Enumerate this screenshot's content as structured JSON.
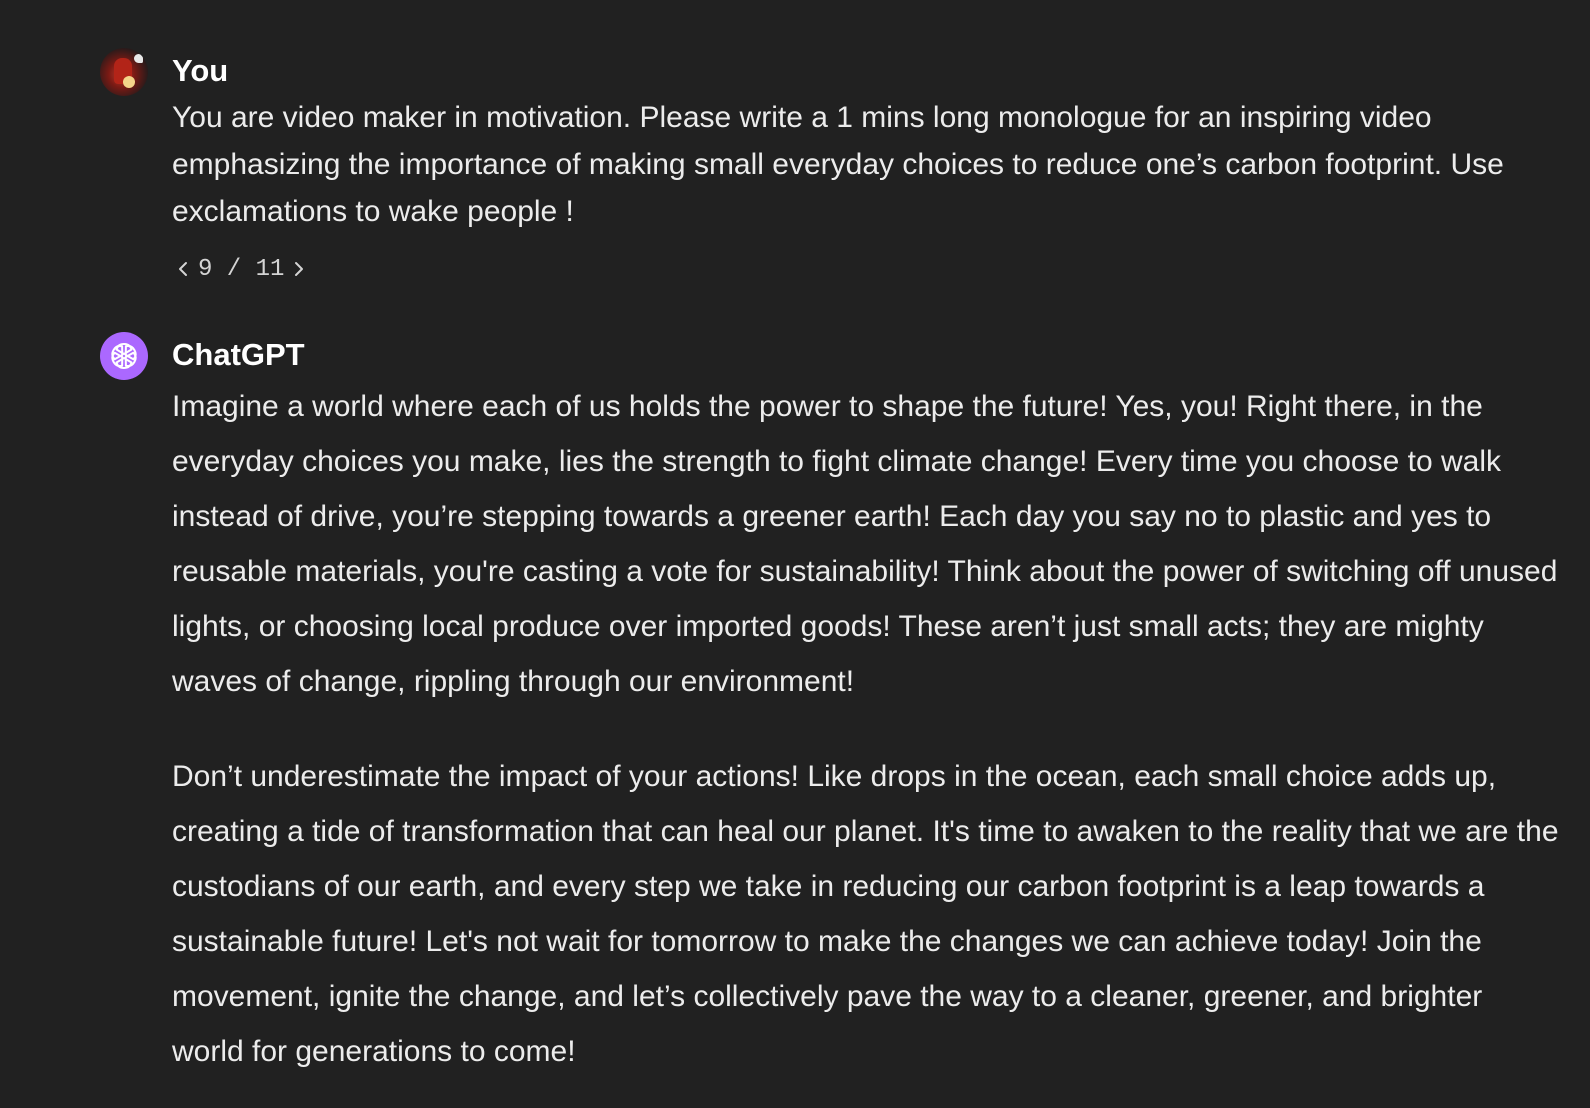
{
  "user_message": {
    "author": "You",
    "avatar_icon": "user-avatar-icon",
    "text": "You are video maker in motivation. Please write a 1 mins long monologue for an inspiring video emphasizing the importance of making small everyday choices to reduce one’s carbon footprint. Use exclamations to wake people !",
    "pager": {
      "prev_icon": "chevron-left-icon",
      "label": "9 / 11",
      "next_icon": "chevron-right-icon"
    }
  },
  "assistant_message": {
    "author": "ChatGPT",
    "avatar_icon": "openai-logo-icon",
    "accent_color": "#ab68ff",
    "paragraphs": [
      "Imagine a world where each of us holds the power to shape the future! Yes, you! Right there, in the everyday choices you make, lies the strength to fight climate change! Every time you choose to walk instead of drive, you’re stepping towards a greener earth! Each day you say no to plastic and yes to reusable materials, you're casting a vote for sustainability! Think about the power of switching off unused lights, or choosing local produce over imported goods! These aren’t just small acts; they are mighty waves of change, rippling through our environment!",
      "Don’t underestimate the impact of your actions! Like drops in the ocean, each small choice adds up, creating a tide of transformation that can heal our planet. It's time to awaken to the reality that we are the custodians of our earth, and every step we take in reducing our carbon footprint is a leap towards a sustainable future! Let's not wait for tomorrow to make the changes we can achieve today! Join the movement, ignite the change, and let’s collectively pave the way to a cleaner, greener, and brighter world for generations to come!"
    ]
  }
}
